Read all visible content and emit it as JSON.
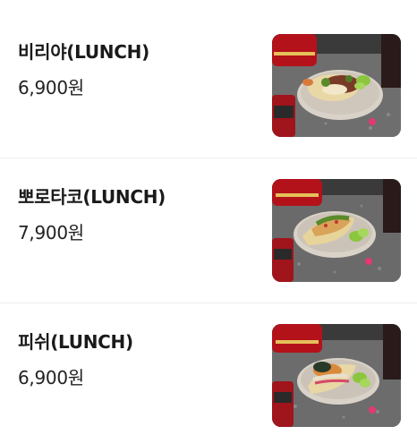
{
  "menu": {
    "items": [
      {
        "name": "비리야(LUNCH)",
        "price": "6,900원",
        "image_icon": "birria-taco-photo"
      },
      {
        "name": "뽀로타코(LUNCH)",
        "price": "7,900원",
        "image_icon": "porotaco-photo"
      },
      {
        "name": "피쉬(LUNCH)",
        "price": "6,900원",
        "image_icon": "fish-taco-photo"
      }
    ]
  },
  "colors": {
    "granite": "#6b6b6b",
    "can_red": "#b3121a",
    "plate": "#d9d2c8",
    "lime": "#8cc63f"
  }
}
